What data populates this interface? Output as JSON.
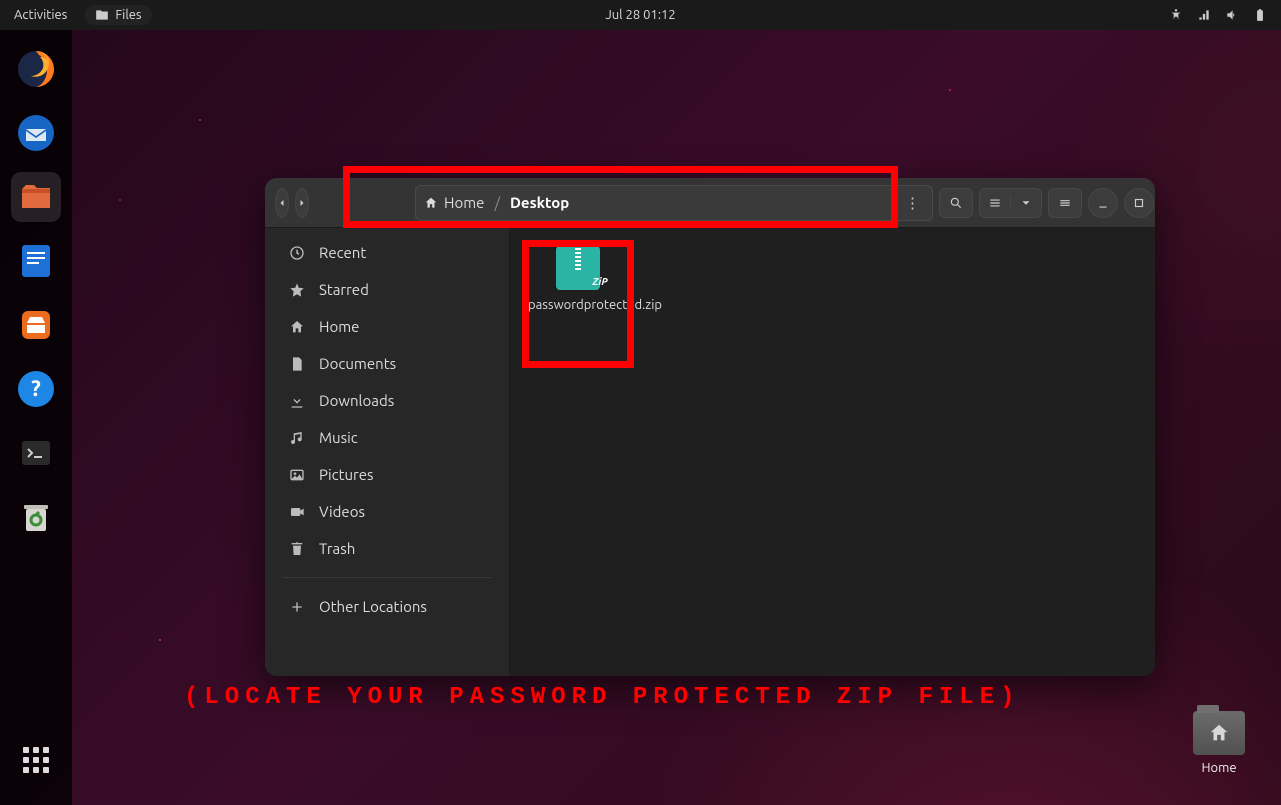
{
  "topbar": {
    "activities": "Activities",
    "app_label": "Files",
    "clock": "Jul 28  01:12"
  },
  "dock": {
    "items": [
      {
        "name": "firefox"
      },
      {
        "name": "thunderbird"
      },
      {
        "name": "files",
        "active": true
      },
      {
        "name": "libreoffice-writer"
      },
      {
        "name": "ubuntu-software"
      },
      {
        "name": "help"
      },
      {
        "name": "terminal"
      },
      {
        "name": "trash"
      }
    ],
    "apps_button": "Show Applications"
  },
  "desktop_icon": {
    "label": "Home"
  },
  "files_window": {
    "sidebar": {
      "items": [
        {
          "label": "Recent",
          "icon": "clock"
        },
        {
          "label": "Starred",
          "icon": "star"
        },
        {
          "label": "Home",
          "icon": "home"
        },
        {
          "label": "Documents",
          "icon": "document"
        },
        {
          "label": "Downloads",
          "icon": "download"
        },
        {
          "label": "Music",
          "icon": "music"
        },
        {
          "label": "Pictures",
          "icon": "image"
        },
        {
          "label": "Videos",
          "icon": "video"
        },
        {
          "label": "Trash",
          "icon": "trash"
        }
      ],
      "other_locations": "Other Locations"
    },
    "path": {
      "crumbs": [
        {
          "label": "Home",
          "icon": "home"
        },
        {
          "label": "Desktop"
        }
      ]
    },
    "file": {
      "name": "passwordprotected.zip"
    }
  },
  "annotation": {
    "caption": "(LOCATE YOUR PASSWORD PROTECTED ZIP FILE)"
  }
}
